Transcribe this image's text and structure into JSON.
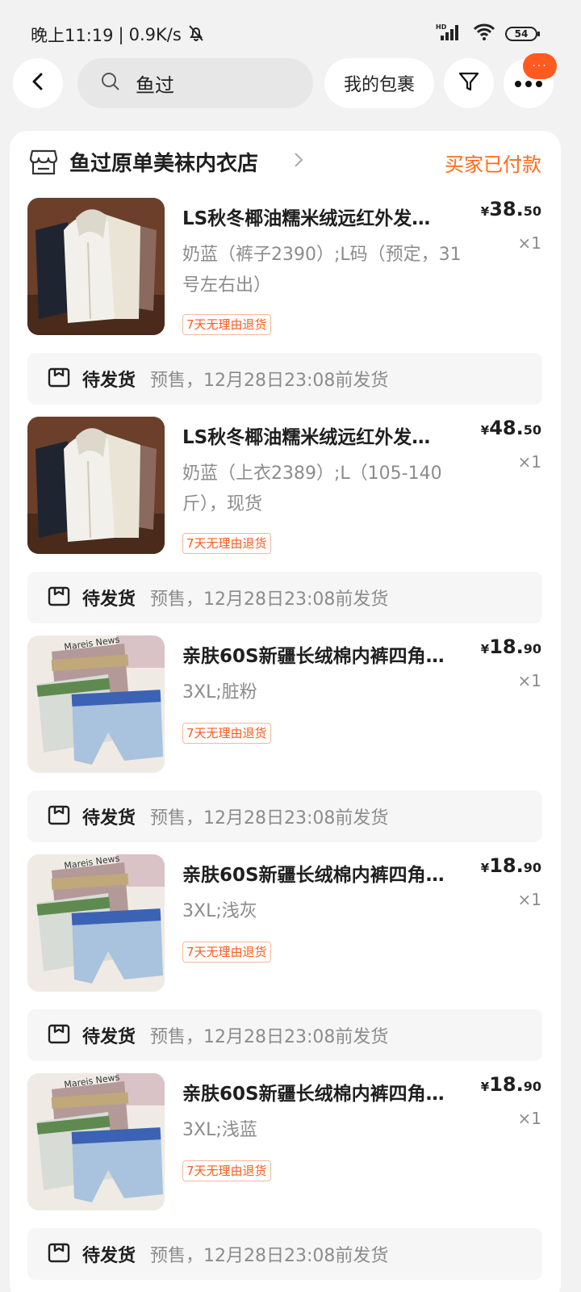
{
  "status_bar": {
    "time": "晚上11:19",
    "separator": "|",
    "speed": "0.9K/s",
    "network_label": "HD",
    "battery": "54"
  },
  "header": {
    "search_text": "鱼过",
    "my_packages_label": "我的包裹",
    "more_badge": "···"
  },
  "shop": {
    "name": "鱼过原单美袜内衣店",
    "order_status": "买家已付款"
  },
  "items": [
    {
      "title": "LS秋冬椰油糯米绒远红外发…",
      "spec": "奶蓝（裤子2390）;L码（预定，31号左右出）",
      "tag": "7天无理由退货",
      "price_symbol": "¥",
      "price_int": "38.",
      "price_dec": "50",
      "qty": "×1",
      "image": "hoodie-set"
    },
    {
      "title": "LS秋冬椰油糯米绒远红外发…",
      "spec": "奶蓝（上衣2389）;L（105-140斤），现货",
      "tag": "7天无理由退货",
      "price_symbol": "¥",
      "price_int": "48.",
      "price_dec": "50",
      "qty": "×1",
      "image": "hoodie-set"
    },
    {
      "title": "亲肤60S新疆长绒棉内裤四角…",
      "spec": "3XL;脏粉",
      "tag": "7天无理由退货",
      "price_symbol": "¥",
      "price_int": "18.",
      "price_dec": "90",
      "qty": "×1",
      "image": "boxer-briefs"
    },
    {
      "title": "亲肤60S新疆长绒棉内裤四角…",
      "spec": "3XL;浅灰",
      "tag": "7天无理由退货",
      "price_symbol": "¥",
      "price_int": "18.",
      "price_dec": "90",
      "qty": "×1",
      "image": "boxer-briefs"
    },
    {
      "title": "亲肤60S新疆长绒棉内裤四角…",
      "spec": "3XL;浅蓝",
      "tag": "7天无理由退货",
      "price_symbol": "¥",
      "price_int": "18.",
      "price_dec": "90",
      "qty": "×1",
      "image": "boxer-briefs"
    }
  ],
  "shipping": {
    "label": "待发货",
    "note": "预售，12月28日23:08前发货"
  },
  "colors": {
    "accent": "#ff6a1a",
    "page_bg": "#f2f2f2",
    "card_bg": "#ffffff"
  }
}
